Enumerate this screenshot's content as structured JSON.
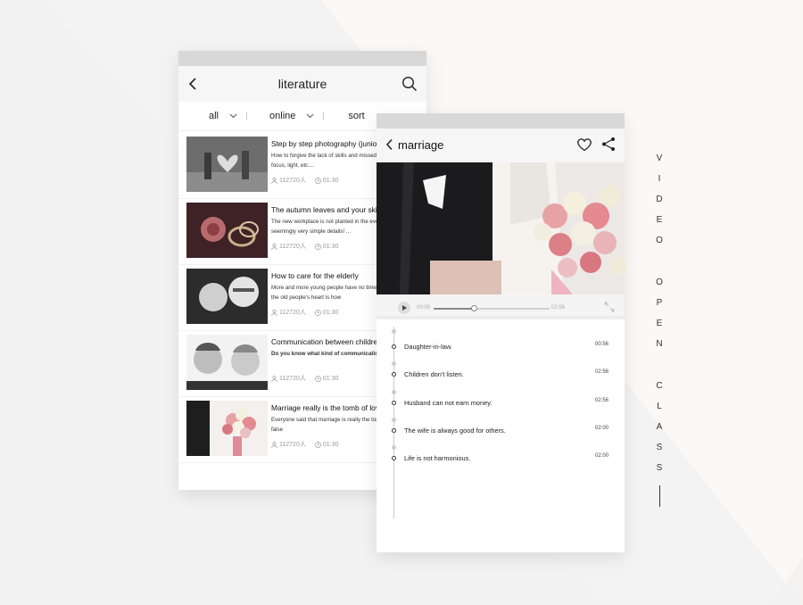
{
  "screen1": {
    "title": "literature",
    "filters": [
      "all",
      "online",
      "sort"
    ],
    "items": [
      {
        "title": "Step by step photography (junior c",
        "desc": "How to forgive the lack of skills and missed? from exposure, focus, light, etc....",
        "views": "112720人",
        "duration": "01:30"
      },
      {
        "title": "The autumn leaves and your skills",
        "desc": "The new workplace is not planted in the eve engage in seemingly very simple details! ...",
        "views": "112720人",
        "duration": "01:30"
      },
      {
        "title": "How to care for the elderly",
        "desc": "More and more young people have no time t the elderly, so the old people's heart is how",
        "views": "112720人",
        "duration": "01:30"
      },
      {
        "title": "Communication between children",
        "desc": "Do you know what kind of communication children",
        "views": "112720人",
        "duration": "01:30"
      },
      {
        "title": "Marriage really is the tomb of love",
        "desc": "Everyone said that marriage is really the tom the end is really false",
        "views": "112720人",
        "duration": "01:30"
      }
    ]
  },
  "screen2": {
    "title": "marriage",
    "player": {
      "current": "00:00",
      "total": "02:56",
      "progress": 0.35
    },
    "chapters": [
      {
        "title": "Daughter-in-law.",
        "time": "00:56"
      },
      {
        "title": "Children don't listen.",
        "time": "02:56"
      },
      {
        "title": "Husband can not earn money.",
        "time": "02:56"
      },
      {
        "title": "The wife is always good for others.",
        "time": "02:00"
      },
      {
        "title": "Life is not harmonious.",
        "time": "02:00"
      }
    ]
  },
  "side_text": [
    "V",
    "I",
    "D",
    "E",
    "O",
    "",
    "O",
    "P",
    "E",
    "N",
    "",
    "C",
    "L",
    "A",
    "S",
    "S"
  ],
  "colors": {
    "accent_rose": "#e48a90",
    "statusbar": "#d8d8d8"
  }
}
